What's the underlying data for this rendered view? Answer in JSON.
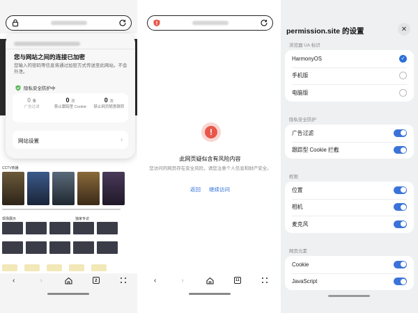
{
  "panel1": {
    "security_card": {
      "title": "您与网站之间的连接已加密",
      "description": "您输入的密码等信息将通过加密方式传送至此网站，不会外泄。",
      "privacy_label": "隐私安全防护中",
      "stats": [
        {
          "num": "0",
          "unit": "条",
          "label": "广告过滤"
        },
        {
          "num": "0",
          "unit": "次",
          "label": "禁止跟踪型 Cookie"
        },
        {
          "num": "0",
          "unit": "次",
          "label": "禁止网页随意跳转"
        }
      ],
      "site_settings_label": "网站设置"
    },
    "bg_sections": {
      "cctv": "CCTV热播",
      "row2": "现场展示",
      "row2b": "独家专访"
    },
    "tab_count": "2"
  },
  "panel2": {
    "warning_title": "此网页疑似含有风险内容",
    "warning_desc": "您访问的网页存在安全风险，请您注意个人信息和财产安全。",
    "back_link": "返回",
    "continue_link": "继续访问",
    "tab_count": "11"
  },
  "panel3": {
    "title": "permission.site 的设置",
    "ua_group": "浏览器 UA 标识",
    "ua_options": [
      {
        "label": "HarmonyOS",
        "selected": true
      },
      {
        "label": "手机版",
        "selected": false
      },
      {
        "label": "电脑版",
        "selected": false
      }
    ],
    "privacy_group": "隐私安全防护",
    "privacy_items": [
      {
        "label": "广告过滤",
        "on": true
      },
      {
        "label": "跟踪型 Cookie 拦截",
        "on": true
      }
    ],
    "perm_group": "权限",
    "perm_items": [
      {
        "label": "位置",
        "on": true
      },
      {
        "label": "相机",
        "on": true
      },
      {
        "label": "麦克风",
        "on": true
      }
    ],
    "elem_group": "网页元素",
    "elem_items": [
      {
        "label": "Cookie",
        "on": true
      },
      {
        "label": "JavaScript",
        "on": true
      }
    ]
  },
  "colors": {
    "accent": "#3b73d9",
    "danger": "#e8574a"
  }
}
